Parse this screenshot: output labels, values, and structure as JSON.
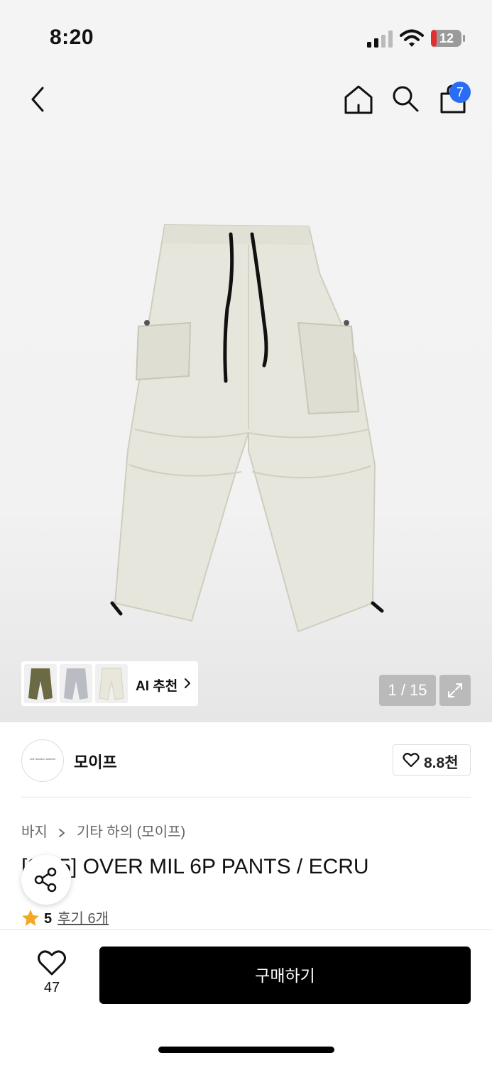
{
  "status_bar": {
    "time": "8:20",
    "battery_level": "12",
    "battery_fill": 0.12
  },
  "header": {
    "icons": [
      "back-icon",
      "home-icon",
      "search-icon",
      "shopping-bag-icon"
    ],
    "cart_count": "7"
  },
  "gallery": {
    "counter": "1 / 15",
    "ai_recommend_label": "AI 추천",
    "thumbnails": [
      "olive",
      "light-gray",
      "ecru"
    ],
    "colors": {
      "olive": "#6b6a45",
      "light-gray": "#b9bcc2",
      "ecru": "#e9e7dc",
      "product": "#e7e6dc"
    }
  },
  "brand": {
    "name": "모이프",
    "logo_text": "mof function uniform",
    "likes": "8.8천"
  },
  "product": {
    "breadcrumb": [
      "바지",
      "기타 하의 (모이프)"
    ],
    "title": "[S/25] OVER MIL 6P PANTS / ECRU",
    "rating": "5",
    "reviews_label": "후기 6개"
  },
  "bottom_bar": {
    "wish_count": "47",
    "buy_label": "구매하기"
  },
  "accent": {
    "badge": "#2a6df4",
    "star": "#f5a623"
  }
}
